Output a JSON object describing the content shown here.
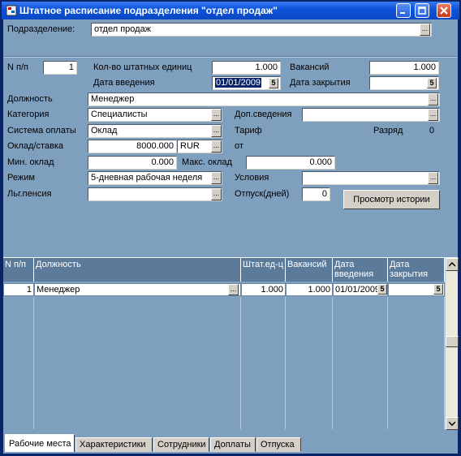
{
  "window": {
    "title": "Штатное расписание подразделения \"отдел продаж\""
  },
  "header": {
    "subdivision_label": "Подразделение:",
    "subdivision_value": "отдел продаж"
  },
  "form": {
    "npp_label": "N п/п",
    "npp_value": "1",
    "units_label": "Кол-во штатных единиц",
    "units_value": "1.000",
    "vacancies_label": "Вакансий",
    "vacancies_value": "1.000",
    "intro_date_label": "Дата введения",
    "intro_date_value": "01/01/2009",
    "close_date_label": "Дата закрытия",
    "close_date_value": "",
    "position_label": "Должность",
    "position_value": "Менеджер",
    "category_label": "Категория",
    "category_value": "Специалисты",
    "extra_info_label": "Доп.сведения",
    "extra_info_value": "",
    "pay_system_label": "Система оплаты",
    "pay_system_value": "Оклад",
    "tariff_label": "Тариф",
    "rank_label": "Разряд",
    "rank_value": "0",
    "salary_label": "Оклад/ставка",
    "salary_value": "8000.000",
    "currency_value": "RUR",
    "from_label": "от",
    "min_salary_label": "Мин. оклад",
    "min_salary_value": "0.000",
    "max_salary_label": "Макс. оклад",
    "max_salary_value": "0.000",
    "mode_label": "Режим",
    "mode_value": "5-дневная рабочая неделя",
    "conditions_label": "Условия",
    "conditions_value": "",
    "benefits_label": "Льг.пенсия",
    "benefits_value": "",
    "vacation_label": "Отпуск(дней)",
    "vacation_value": "0",
    "history_button": "Просмотр истории",
    "ellipsis": "...",
    "calendar_glyph": "5"
  },
  "grid": {
    "columns": [
      "N п/п",
      "Должность",
      "Штат.ед-ц",
      "Вакансий",
      "Дата введения",
      "Дата закрытия"
    ],
    "rows": [
      {
        "npp": "1",
        "position": "Менеджер",
        "units": "1.000",
        "vacancies": "1.000",
        "intro_date": "01/01/2009",
        "close_date": ""
      }
    ]
  },
  "tabs": [
    "Рабочие места",
    "Характеристики",
    "Сотрудники",
    "Доплаты",
    "Отпуска"
  ],
  "colors": {
    "titlebar": "#0d55dc",
    "form_bg": "#7f9fbf",
    "grid_header": "#5c7b9b"
  }
}
